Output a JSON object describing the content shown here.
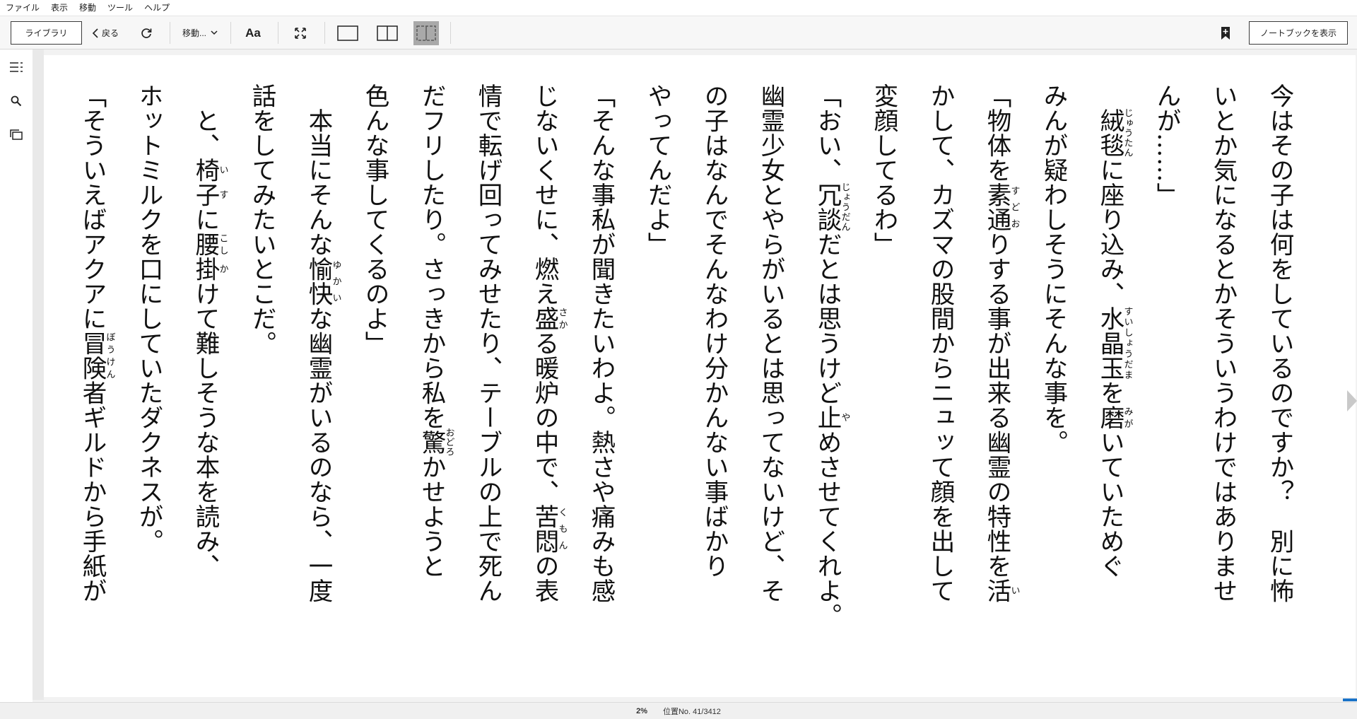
{
  "menubar": {
    "items": [
      "ファイル",
      "表示",
      "移動",
      "ツール",
      "ヘルプ"
    ]
  },
  "toolbar": {
    "library_label": "ライブラリ",
    "back_label": "戻る",
    "goto_label": "移動...",
    "font_label": "Aa",
    "notebook_label": "ノートブックを表示"
  },
  "reader": {
    "lines": [
      [
        {
          "t": "今はその子は何をしているのですか？　別に怖"
        }
      ],
      [
        {
          "t": "いとか気になるとかそういうわけではありませ"
        }
      ],
      [
        {
          "t": "んが……」"
        }
      ],
      [
        {
          "t": "　"
        },
        {
          "t": "絨毯",
          "r": "じゅうたん"
        },
        {
          "t": "に座り込み、"
        },
        {
          "t": "水晶玉",
          "r": "すいしょうだま"
        },
        {
          "t": "を"
        },
        {
          "t": "磨",
          "r": "みが"
        },
        {
          "t": "いていためぐ"
        }
      ],
      [
        {
          "t": "みんが疑わしそうにそんな事を。"
        }
      ],
      [
        {
          "t": "「物体を"
        },
        {
          "t": "素通",
          "r": "すどお"
        },
        {
          "t": "りする事が出来る幽霊の特性を"
        },
        {
          "t": "活",
          "r": "い"
        }
      ],
      [
        {
          "t": "かして、カズマの股間からニュッて顔を出して"
        }
      ],
      [
        {
          "t": "変顔してるわ」"
        }
      ],
      [
        {
          "t": "「おい、"
        },
        {
          "t": "冗談",
          "r": "じょうだん"
        },
        {
          "t": "だとは思うけど"
        },
        {
          "t": "止",
          "r": "や"
        },
        {
          "t": "めさせてくれよ。"
        }
      ],
      [
        {
          "t": "幽霊少女とやらがいるとは思ってないけど、そ"
        }
      ],
      [
        {
          "t": "の子はなんでそんなわけ分かんない事ばかり"
        }
      ],
      [
        {
          "t": "やってんだよ」"
        }
      ],
      [
        {
          "t": "「そんな事私が聞きたいわよ。熱さや痛みも感"
        }
      ],
      [
        {
          "t": "じないくせに、燃え"
        },
        {
          "t": "盛",
          "r": "さか"
        },
        {
          "t": "る暖炉の中で、"
        },
        {
          "t": "苦悶",
          "r": "くもん"
        },
        {
          "t": "の表"
        }
      ],
      [
        {
          "t": "情で転げ回ってみせたり、テーブルの上で死ん"
        }
      ],
      [
        {
          "t": "だフリしたり。さっきから私を"
        },
        {
          "t": "驚",
          "r": "おどろ"
        },
        {
          "t": "かせようと"
        }
      ],
      [
        {
          "t": "色んな事してくるのよ」"
        }
      ],
      [
        {
          "t": "　本当にそんな"
        },
        {
          "t": "愉快",
          "r": "ゆかい"
        },
        {
          "t": "な幽霊がいるのなら、一度"
        }
      ],
      [
        {
          "t": "話をしてみたいとこだ。"
        }
      ],
      [
        {
          "t": "　と、"
        },
        {
          "t": "椅子",
          "r": "いす"
        },
        {
          "t": "に"
        },
        {
          "t": "腰",
          "r": "こし"
        },
        {
          "t": "掛",
          "r": "か"
        },
        {
          "t": "けて難しそうな本を読み、"
        }
      ],
      [
        {
          "t": "ホットミルクを口にしていたダクネスが。"
        }
      ],
      [
        {
          "t": "「そういえばアクアに"
        },
        {
          "t": "冒険",
          "r": "ぼうけん"
        },
        {
          "t": "者ギルドから手紙が"
        }
      ]
    ]
  },
  "status": {
    "percent": "2%",
    "location": "位置No. 41/3412"
  }
}
